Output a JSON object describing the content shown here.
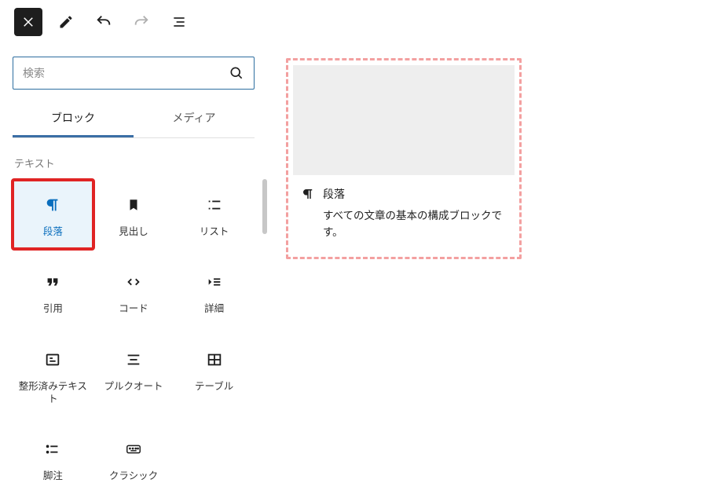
{
  "accent_color": "#3b6ea5",
  "highlight_color": "#e02424",
  "dashed_color": "#f3a0a0",
  "toolbar": {},
  "search": {
    "placeholder": "検索"
  },
  "tabs": {
    "blocks": "ブロック",
    "media": "メディア"
  },
  "section": {
    "text": "テキスト"
  },
  "blocks": {
    "paragraph": "段落",
    "heading": "見出し",
    "list": "リスト",
    "quote": "引用",
    "code": "コード",
    "details": "詳細",
    "preformatted": "整形済みテキスト",
    "pullquote": "プルクオート",
    "table": "テーブル",
    "footnote": "脚注",
    "classic": "クラシック"
  },
  "preview": {
    "title": "段落",
    "desc": "すべての文章の基本の構成ブロックです。"
  }
}
